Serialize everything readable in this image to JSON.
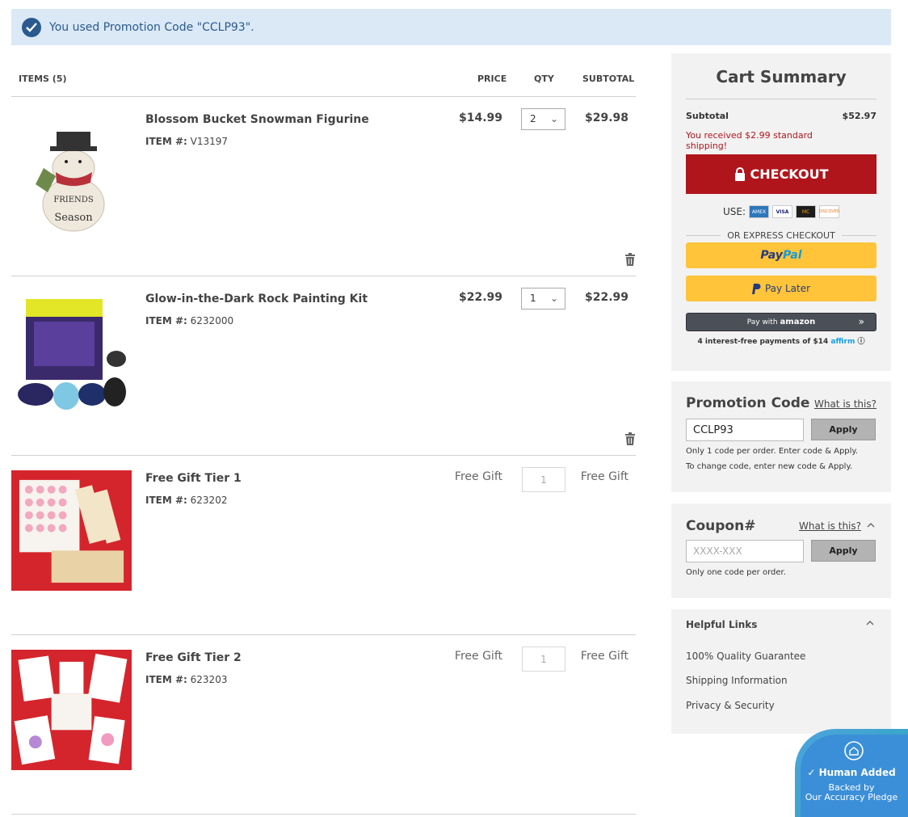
{
  "banner": {
    "message": "You used Promotion Code \"CCLP93\"."
  },
  "cart": {
    "headers": {
      "items": "ITEMS (5)",
      "price": "PRICE",
      "qty": "QTY",
      "subtotal": "SUBTOTAL"
    },
    "item_label": "ITEM #:",
    "rows": [
      {
        "name": "Blossom Bucket Snowman Figurine",
        "item_no": "V13197",
        "price": "$14.99",
        "qty": "2",
        "subtotal": "$29.98"
      },
      {
        "name": "Glow-in-the-Dark Rock Painting Kit",
        "item_no": "6232000",
        "price": "$22.99",
        "qty": "1",
        "subtotal": "$22.99"
      },
      {
        "name": "Free Gift Tier 1",
        "item_no": "623202",
        "price": "Free Gift",
        "qty": "1",
        "subtotal": "Free Gift"
      },
      {
        "name": "Free Gift Tier 2",
        "item_no": "623203",
        "price": "Free Gift",
        "qty": "1",
        "subtotal": "Free Gift"
      }
    ]
  },
  "summary": {
    "title": "Cart Summary",
    "subtotal_label": "Subtotal",
    "subtotal_value": "$52.97",
    "shipping_note": "You received $2.99 standard shipping!",
    "checkout_label": "CHECKOUT",
    "use_label": "USE:",
    "cards": [
      "AMEX",
      "VISA",
      "MC",
      "DISCOVER"
    ],
    "express_label": "OR EXPRESS CHECKOUT",
    "paypal_1": "Pay",
    "paypal_2": "Pal",
    "paylater_label": "Pay Later",
    "amazon_label": "Pay with",
    "amazon_brand": "amazon",
    "affirm_text": "4 interest-free payments of $14",
    "affirm_brand": "affirm"
  },
  "promo": {
    "title": "Promotion Code",
    "what_link": "What is this?",
    "input_value": "CCLP93",
    "apply_label": "Apply",
    "note_1": "Only 1 code per order. Enter code & Apply.",
    "note_2": "To change code, enter new code & Apply."
  },
  "coupon": {
    "title": "Coupon#",
    "what_link": "What is this?",
    "placeholder": "XXXX-XXX",
    "apply_label": "Apply",
    "note": "Only one code per order."
  },
  "helpful": {
    "title": "Helpful Links",
    "links": [
      "100% Quality Guarantee",
      "Shipping Information",
      "Privacy & Security"
    ]
  },
  "badge": {
    "title": "Human Added",
    "line_1": "Backed by",
    "line_2": "Our Accuracy Pledge"
  },
  "colors": {
    "checkout": "#b1151c",
    "banner": "#dbe9f7",
    "paypal": "#ffc439"
  }
}
